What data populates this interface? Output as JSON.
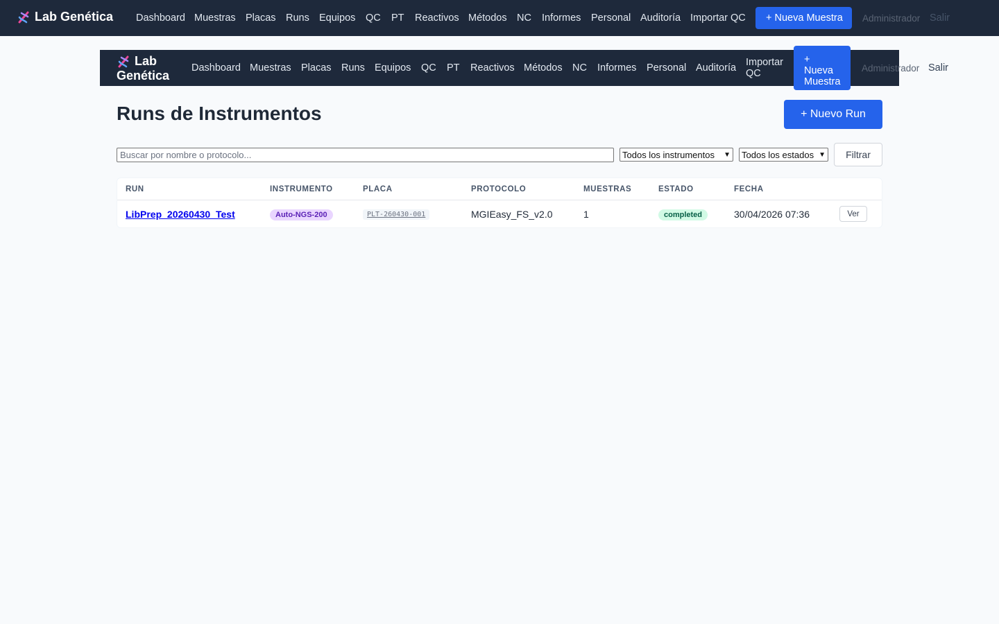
{
  "app": {
    "brand": "Lab Genética",
    "brand_line1": "Lab",
    "brand_line2": "Genética"
  },
  "nav": {
    "items": [
      "Dashboard",
      "Muestras",
      "Placas",
      "Runs",
      "Equipos",
      "QC",
      "PT",
      "Reactivos",
      "Métodos",
      "NC",
      "Informes",
      "Personal",
      "Auditoría",
      "Importar QC"
    ],
    "sub_import_line1": "Importar",
    "sub_import_line2": "QC",
    "new_sample": "+ Nueva Muestra",
    "new_sample_l1": "+",
    "new_sample_l2": "Nueva",
    "new_sample_l3": "Muestra",
    "user": "Administrador",
    "logout": "Salir"
  },
  "page": {
    "title": "Runs de Instrumentos",
    "new_run": "+ Nuevo Run"
  },
  "filters": {
    "search_placeholder": "Buscar por nombre o protocolo...",
    "instrument_selected": "Todos los instrumentos",
    "status_selected": "Todos los estados",
    "filter_button": "Filtrar"
  },
  "table": {
    "headers": [
      "RUN",
      "INSTRUMENTO",
      "PLACA",
      "PROTOCOLO",
      "MUESTRAS",
      "ESTADO",
      "FECHA"
    ],
    "rows": [
      {
        "run": "LibPrep_20260430_Test",
        "instrument": "Auto-NGS-200",
        "plate": "PLT-260430-001",
        "protocol": "MGIEasy_FS_v2.0",
        "samples": "1",
        "status": "completed",
        "date": "30/04/2026 07:36",
        "action": "Ver"
      }
    ]
  },
  "colors": {
    "nav_bg": "#1e293b",
    "primary": "#2563eb",
    "instrument_badge": "#e9d5ff",
    "status_badge": "#d1fae5"
  }
}
